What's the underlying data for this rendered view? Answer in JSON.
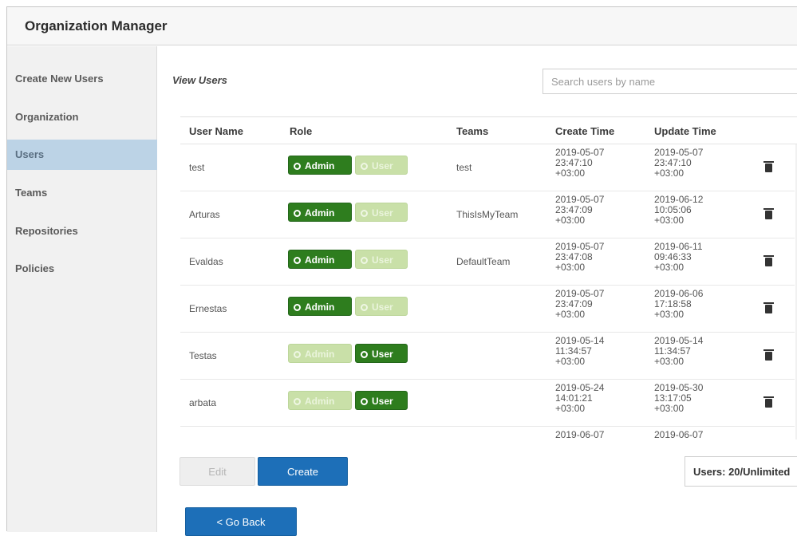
{
  "app": {
    "title": "Organization Manager"
  },
  "sidebar": {
    "items": [
      {
        "label": "Create New Users",
        "active": false
      },
      {
        "label": "Organization",
        "active": false
      },
      {
        "label": "Users",
        "active": true
      },
      {
        "label": "Teams",
        "active": false
      },
      {
        "label": "Repositories",
        "active": false
      },
      {
        "label": "Policies",
        "active": false
      }
    ]
  },
  "main": {
    "view_title": "View Users",
    "search": {
      "placeholder": "Search users by name",
      "value": ""
    },
    "table": {
      "headers": [
        "User Name",
        "Role",
        "Teams",
        "Create Time",
        "Update Time"
      ],
      "role_labels": {
        "admin": "Admin",
        "user": "User"
      },
      "rows": [
        {
          "name": "test",
          "role": "Admin",
          "team": "test",
          "create": [
            "2019-05-07",
            "23:47:10",
            "+03:00"
          ],
          "update": [
            "2019-05-07",
            "23:47:10",
            "+03:00"
          ]
        },
        {
          "name": "Arturas",
          "role": "Admin",
          "team": "ThisIsMyTeam",
          "create": [
            "2019-05-07",
            "23:47:09",
            "+03:00"
          ],
          "update": [
            "2019-06-12",
            "10:05:06",
            "+03:00"
          ]
        },
        {
          "name": "Evaldas",
          "role": "Admin",
          "team": "DefaultTeam",
          "create": [
            "2019-05-07",
            "23:47:08",
            "+03:00"
          ],
          "update": [
            "2019-06-11",
            "09:46:33",
            "+03:00"
          ]
        },
        {
          "name": "Ernestas",
          "role": "Admin",
          "team": "",
          "create": [
            "2019-05-07",
            "23:47:09",
            "+03:00"
          ],
          "update": [
            "2019-06-06",
            "17:18:58",
            "+03:00"
          ]
        },
        {
          "name": "Testas",
          "role": "User",
          "team": "",
          "create": [
            "2019-05-14",
            "11:34:57",
            "+03:00"
          ],
          "update": [
            "2019-05-14",
            "11:34:57",
            "+03:00"
          ]
        },
        {
          "name": "arbata",
          "role": "User",
          "team": "",
          "create": [
            "2019-05-24",
            "14:01:21",
            "+03:00"
          ],
          "update": [
            "2019-05-30",
            "13:17:05",
            "+03:00"
          ]
        },
        {
          "name": "",
          "role": "",
          "team": "",
          "create": [
            "2019-06-07",
            "",
            ""
          ],
          "update": [
            "2019-06-07",
            "",
            ""
          ]
        }
      ]
    },
    "buttons": {
      "edit": "Edit",
      "create": "Create",
      "back": "< Go Back"
    },
    "users_count": "Users: 20/Unlimited"
  },
  "colors": {
    "accent": "#1d6fb8",
    "role_active": "#2e7d1e",
    "role_inactive": "#c9e0a8",
    "sidebar_active": "#bcd3e6"
  },
  "icons": {
    "delete": "trash-icon",
    "role_selected": "radio-dot-icon"
  }
}
